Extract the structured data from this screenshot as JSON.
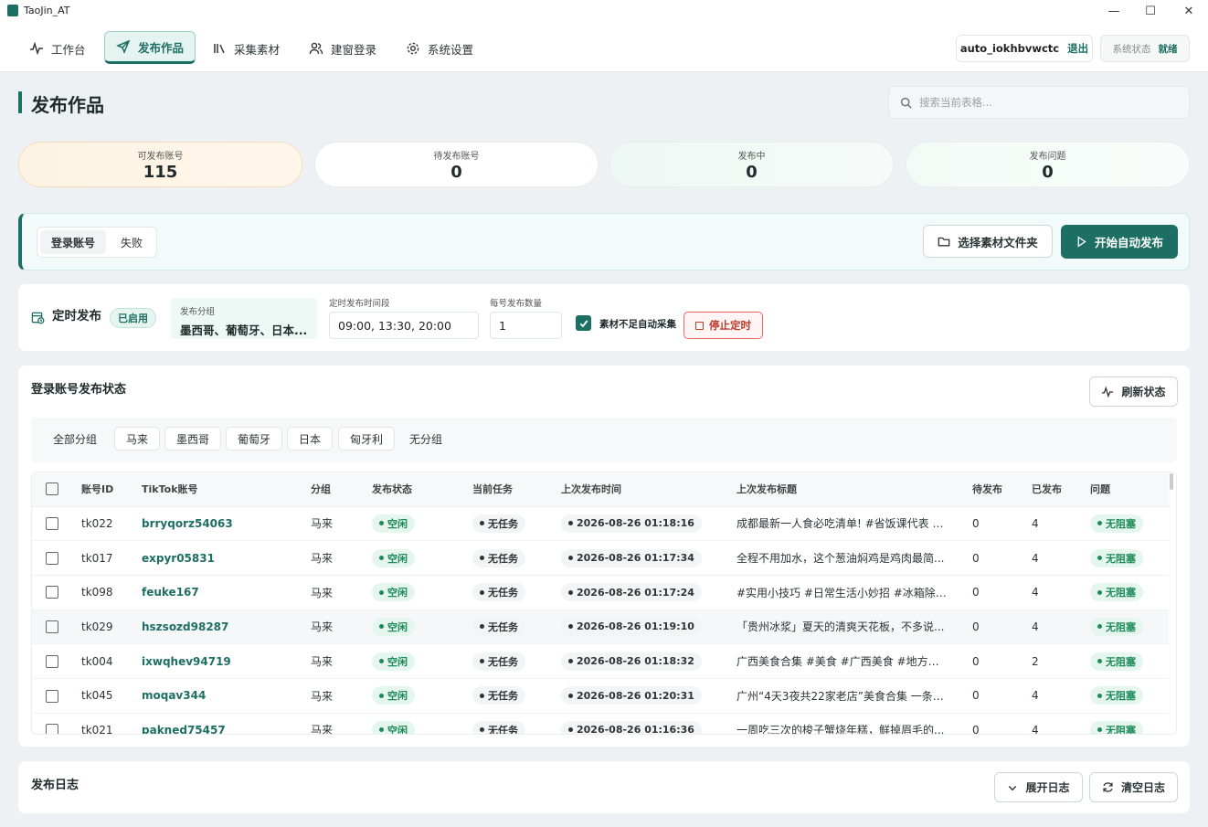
{
  "app": {
    "title": "TaoJin_AT"
  },
  "window": {
    "minimize": "—",
    "maximize": "☐",
    "close": "✕"
  },
  "nav": {
    "items": [
      {
        "label": "工作台",
        "icon": "activity-icon"
      },
      {
        "label": "发布作品",
        "icon": "send-icon",
        "active": true
      },
      {
        "label": "采集素材",
        "icon": "library-icon"
      },
      {
        "label": "建窗登录",
        "icon": "users-icon"
      },
      {
        "label": "系统设置",
        "icon": "gear-icon"
      }
    ],
    "user": "auto_iokhbvwctc",
    "logout": "退出",
    "system_status_label": "系统状态",
    "system_status_value": "就绪"
  },
  "page": {
    "title": "发布作品",
    "search_placeholder": "搜索当前表格..."
  },
  "stats": [
    {
      "label": "可发布账号",
      "value": "115"
    },
    {
      "label": "待发布账号",
      "value": "0"
    },
    {
      "label": "发布中",
      "value": "0"
    },
    {
      "label": "发布问题",
      "value": "0"
    }
  ],
  "login_panel": {
    "tabs": [
      "登录账号",
      "失败"
    ],
    "select_folder": "选择素材文件夹",
    "start_publish": "开始自动发布"
  },
  "schedule": {
    "title": "定时发布",
    "enabled_badge": "已启用",
    "group_label": "发布分组",
    "group_value": "墨西哥、葡萄牙、日本...",
    "time_label": "定时发布时间段",
    "time_value": "09:00, 13:30, 20:00",
    "count_label": "每号发布数量",
    "count_value": "1",
    "auto_collect_label": "素材不足自动采集",
    "stop_label": "停止定时"
  },
  "status_section": {
    "title": "登录账号发布状态",
    "refresh": "刷新状态",
    "filters": [
      "全部分组",
      "马来",
      "墨西哥",
      "葡萄牙",
      "日本",
      "匈牙利",
      "无分组"
    ],
    "columns": [
      "账号ID",
      "TikTok账号",
      "分组",
      "发布状态",
      "当前任务",
      "上次发布时间",
      "上次发布标题",
      "待发布",
      "已发布",
      "问题"
    ],
    "rows": [
      {
        "id": "tk022",
        "tiktok": "brryqorz54063",
        "group": "马来",
        "status": "空闲",
        "task": "无任务",
        "time": "2026-08-26 01:18:16",
        "title": "成都最新一人食必吃清单! #省饭课代表 #...",
        "pending": "0",
        "published": "4",
        "issue": "无阻塞"
      },
      {
        "id": "tk017",
        "tiktok": "expyr05831",
        "group": "马来",
        "status": "空闲",
        "task": "无任务",
        "time": "2026-08-26 01:17:34",
        "title": "全程不用加水，这个葱油焖鸡是鸡肉最简...",
        "pending": "0",
        "published": "4",
        "issue": "无阻塞"
      },
      {
        "id": "tk098",
        "tiktok": "feuke167",
        "group": "马来",
        "status": "空闲",
        "task": "无任务",
        "time": "2026-08-26 01:17:24",
        "title": "#实用小技巧 #日常生活小妙招 #冰箱除异...",
        "pending": "0",
        "published": "4",
        "issue": "无阻塞"
      },
      {
        "id": "tk029",
        "tiktok": "hszsozd98287",
        "group": "马来",
        "status": "空闲",
        "task": "无任务",
        "time": "2026-08-26 01:19:10",
        "title": "「贵州冰浆」夏天的清爽天花板，不多说...",
        "pending": "0",
        "published": "4",
        "issue": "无阻塞"
      },
      {
        "id": "tk004",
        "tiktok": "ixwqhev94719",
        "group": "马来",
        "status": "空闲",
        "task": "无任务",
        "time": "2026-08-26 01:18:32",
        "title": "广西美食合集 #美食 #广西美食 #地方特色...",
        "pending": "0",
        "published": "2",
        "issue": "无阻塞"
      },
      {
        "id": "tk045",
        "tiktok": "moqav344",
        "group": "马来",
        "status": "空闲",
        "task": "无任务",
        "time": "2026-08-26 01:20:31",
        "title": "广州“4天3夜共22家老店”美食合集 一条视...",
        "pending": "0",
        "published": "4",
        "issue": "无阻塞"
      },
      {
        "id": "tk021",
        "tiktok": "pakned75457",
        "group": "马来",
        "status": "空闲",
        "task": "无任务",
        "time": "2026-08-26 01:16:36",
        "title": "一周吃三次的梭子蟹烧年糕，鲜掉眉毛的...",
        "pending": "0",
        "published": "4",
        "issue": "无阻塞"
      }
    ]
  },
  "log_section": {
    "title": "发布日志",
    "expand": "展开日志",
    "clear": "清空日志"
  },
  "colors": {
    "accent": "#1e6f63",
    "danger": "#c0392b",
    "success": "#1c8a59"
  }
}
